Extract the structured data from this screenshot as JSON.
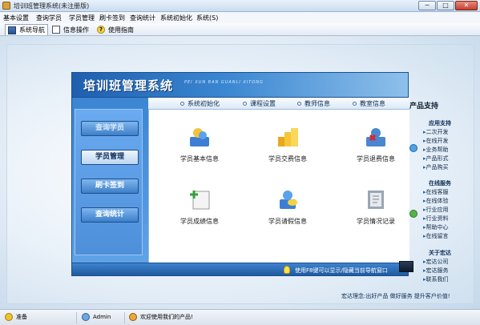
{
  "window": {
    "title": "培训班管理系统(未注册版)",
    "min_glyph": "─",
    "max_glyph": "□",
    "close_glyph": "✕"
  },
  "menu": [
    "基本设置",
    "查询学员",
    "学员管理",
    "刷卡签到",
    "查询统计",
    "系统初始化",
    "系统(S)"
  ],
  "toolbar": {
    "nav_label": "系统导航",
    "info_label": "信息操作",
    "help_label": "使用指南"
  },
  "panel": {
    "title": "培训班管理系统",
    "subtitle": "PEI XUN BAN GUANLI XITONG",
    "left_nav": [
      "查询学员",
      "学员管理",
      "刷卡签到",
      "查询统计"
    ],
    "top_nav": [
      "系统初始化",
      "课程设置",
      "教师信息",
      "教室信息"
    ],
    "tiles": [
      "学员基本信息",
      "学员交费信息",
      "学员退费信息",
      "学员成绩信息",
      "学员请假信息",
      "学员情况记录"
    ],
    "footer_text": "使用F8键可以显示/隐藏当前导航窗口"
  },
  "side": {
    "heading": "产品支持",
    "groups": [
      {
        "title": "应用支持",
        "items": [
          "二次开发",
          "在线开发",
          "业务帮助",
          "产品形式",
          "产品购买"
        ]
      },
      {
        "title": "在线服务",
        "items": [
          "在线客服",
          "在线体验",
          "行业应用",
          "行业资料",
          "帮助中心",
          "在线留言"
        ]
      },
      {
        "title": "关于宏达",
        "items": [
          "宏达公司",
          "宏达服务",
          "联系我们"
        ]
      }
    ],
    "slogan": "宏达理念:出好产品  做好服务  提升客户价值!"
  },
  "status": {
    "ready": "准备",
    "user": "Admin",
    "welcome": "欢迎使用我们的产品!"
  },
  "colors": {
    "accent": "#2f73c0",
    "header_dark": "#1f5fae",
    "content_bg": "#ffffff"
  }
}
